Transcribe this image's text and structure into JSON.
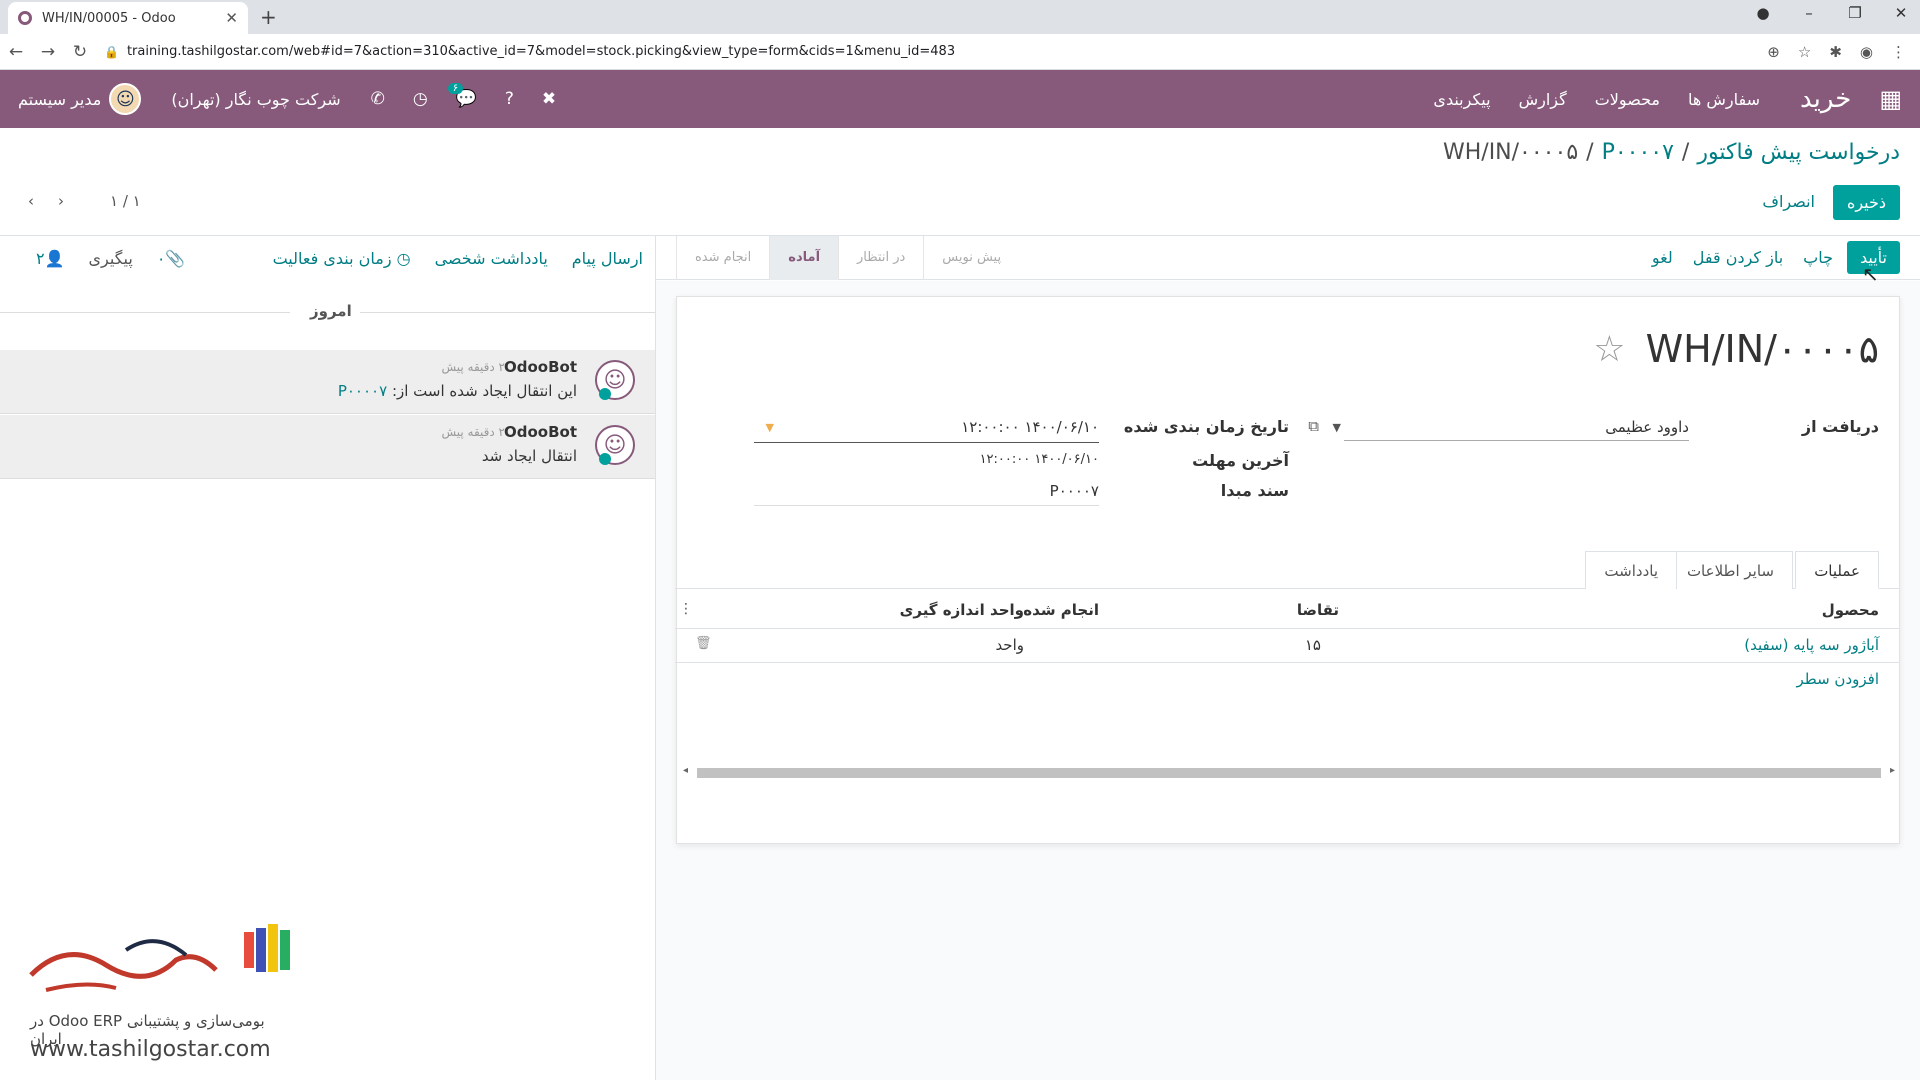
{
  "browser": {
    "tab_title": "WH/IN/00005 - Odoo",
    "url": "training.tashilgostar.com/web#id=7&action=310&active_id=7&model=stock.picking&view_type=form&cids=1&menu_id=483"
  },
  "navbar": {
    "app_name": "خرید",
    "menu": [
      "سفارش ها",
      "محصولات",
      "گزارش",
      "پیکربندی"
    ],
    "messages_badge": "۶",
    "company": "شرکت چوب نگار (تهران)",
    "user": "مدیر سیستم"
  },
  "breadcrumb": {
    "root": "درخواست پیش فاکتور",
    "parent": "P۰۰۰۰۷",
    "current": "WH/IN/۰۰۰۰۵"
  },
  "controls": {
    "save": "ذخیره",
    "discard": "انصراف",
    "pager": "۱ / ۱"
  },
  "statusbar": {
    "confirm": "تأیید",
    "print": "چاپ",
    "unlock": "باز کردن قفل",
    "cancel": "لغو",
    "stages": [
      "پیش نویس",
      "در انتظار",
      "آماده",
      "انجام شده"
    ],
    "active_stage": "آماده"
  },
  "chatter": {
    "send_message": "ارسال پیام",
    "log_note": "یادداشت شخصی",
    "schedule_activity": "زمان بندی فعالیت",
    "attachments": "۰",
    "follow": "پیگیری",
    "followers": "۲",
    "today": "امروز",
    "messages": [
      {
        "author": "OdooBot",
        "time": "۲ دقیقه پیش",
        "body": "این انتقال ایجاد شده است از:",
        "link": "P۰۰۰۰۷"
      },
      {
        "author": "OdooBot",
        "time": "۲ دقیقه پیش",
        "body": "انتقال ایجاد شد",
        "link": ""
      }
    ]
  },
  "record": {
    "title": "WH/IN/۰۰۰۰۵",
    "receive_from_label": "دریافت از",
    "receive_from": "داوود عظیمی",
    "scheduled_date_label": "تاریخ زمان بندی شده",
    "scheduled_date": "۱۴۰۰/۰۶/۱۰ ۱۲:۰۰:۰۰",
    "deadline_label": "آخرین مهلت",
    "deadline": "۱۴۰۰/۰۶/۱۰ ۱۲:۰۰:۰۰",
    "source_label": "سند مبدا",
    "source": "P۰۰۰۰۷"
  },
  "tabs": [
    "عملیات",
    "سایر اطلاعات",
    "یادداشت"
  ],
  "table": {
    "headers": {
      "product": "محصول",
      "demand": "تقاضا",
      "done": "انجام شده",
      "uom": "واحد اندازه گیری"
    },
    "rows": [
      {
        "product": "آباژور سه پایه (سفید)",
        "demand": "۱۵",
        "done": "",
        "uom": "واحد"
      }
    ],
    "add_line": "افزودن سطر"
  },
  "watermark": {
    "tagline": "بومی‌سازی و پشتیبانی Odoo ERP در ایران",
    "url": "www.tashilgostar.com"
  }
}
